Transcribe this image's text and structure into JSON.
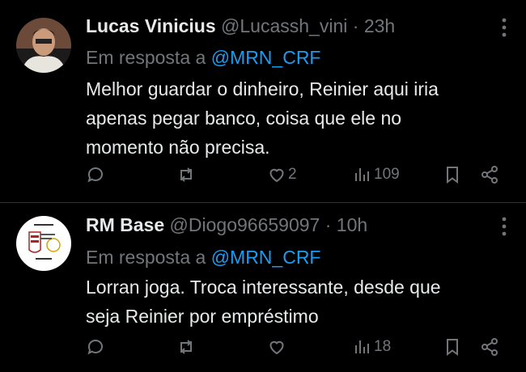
{
  "tweets": [
    {
      "name": "Lucas Vinicius",
      "handle": "@Lucassh_vini",
      "separator": "·",
      "time": "23h",
      "reply_prefix": "Em resposta a",
      "reply_to": "@MRN_CRF",
      "lines": [
        "Melhor guardar o dinheiro, Reinier aqui iria",
        "apenas pegar banco, coisa que ele no",
        "momento não precisa."
      ],
      "likes": "2",
      "views": "109"
    },
    {
      "name": "RM Base",
      "handle": "@Diogo96659097",
      "separator": "·",
      "time": "10h",
      "reply_prefix": "Em resposta a",
      "reply_to": "@MRN_CRF",
      "lines": [
        "Lorran joga. Troca interessante, desde que",
        "seja Reinier por empréstimo"
      ],
      "likes": "",
      "views": "18"
    }
  ],
  "icons": [
    "reply-icon",
    "retweet-icon",
    "like-icon",
    "views-icon",
    "bookmark-icon",
    "share-icon",
    "more-icon"
  ],
  "colors": {
    "background": "#000000",
    "text": "#e7e9ea",
    "muted": "#71767b",
    "link": "#1d9bf0",
    "divider": "#2f3336"
  }
}
